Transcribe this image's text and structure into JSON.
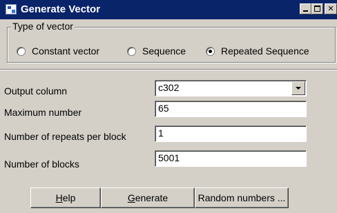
{
  "window": {
    "title": "Generate Vector",
    "controls": {
      "minimize_icon": "minimize-icon",
      "maximize_icon": "maximize-icon",
      "close_icon": "close-icon"
    }
  },
  "vector_type": {
    "legend": "Type of vector",
    "options": [
      {
        "label": "Constant vector",
        "checked": false
      },
      {
        "label": "Sequence",
        "checked": false
      },
      {
        "label": "Repeated Sequence",
        "checked": true
      }
    ]
  },
  "fields": {
    "output_column": {
      "label": "Output column",
      "value": "c302"
    },
    "maximum_number": {
      "label": "Maximum number",
      "value": "65"
    },
    "repeats_per_block": {
      "label": "Number of repeats per block",
      "value": "1"
    },
    "number_of_blocks": {
      "label": "Number of blocks",
      "value": "5001"
    }
  },
  "buttons": {
    "help": {
      "mnemonic": "H",
      "rest": "elp"
    },
    "generate": {
      "mnemonic": "G",
      "rest": "enerate"
    },
    "random": {
      "label": "Random numbers ..."
    }
  },
  "colors": {
    "titlebar": "#0a246a",
    "face": "#d4d0c8"
  }
}
